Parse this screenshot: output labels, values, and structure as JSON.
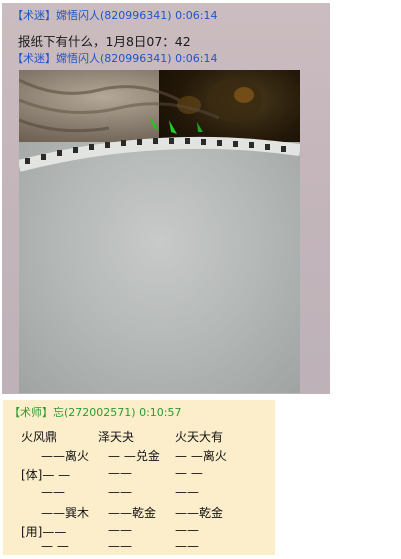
{
  "top_chat": {
    "messages": [
      {
        "tag": "【术迷】",
        "sender": "嫦悟闪人(820996341)",
        "time": "0:06:14"
      },
      {
        "tag": "【术迷】",
        "sender": "嫦悟闪人(820996341)",
        "time": "0:06:14"
      }
    ],
    "text": "报纸下有什么，1月8日07：42",
    "image": "photo-of-paper-roll"
  },
  "bottom_chat": {
    "tag": "【术师】",
    "sender": "忘(272002571)",
    "time": "0:10:57",
    "rows": [
      [
        "火风鼎",
        "泽天夬",
        "火天大有"
      ],
      [
        "——离火",
        "— —兑金",
        "— —离火"
      ],
      [
        "[体]— —",
        "——",
        "— —"
      ],
      [
        "——",
        "——",
        "——"
      ],
      [
        "——巽木",
        "——乾金",
        "——乾金"
      ],
      [
        "[用]——",
        "——",
        "——"
      ],
      [
        "— —",
        "——",
        "——"
      ]
    ]
  },
  "colors": {
    "tag_blue": "#1f56c6",
    "tag_green": "#2e9a2e",
    "bottom_bg": "#fdeecb"
  }
}
